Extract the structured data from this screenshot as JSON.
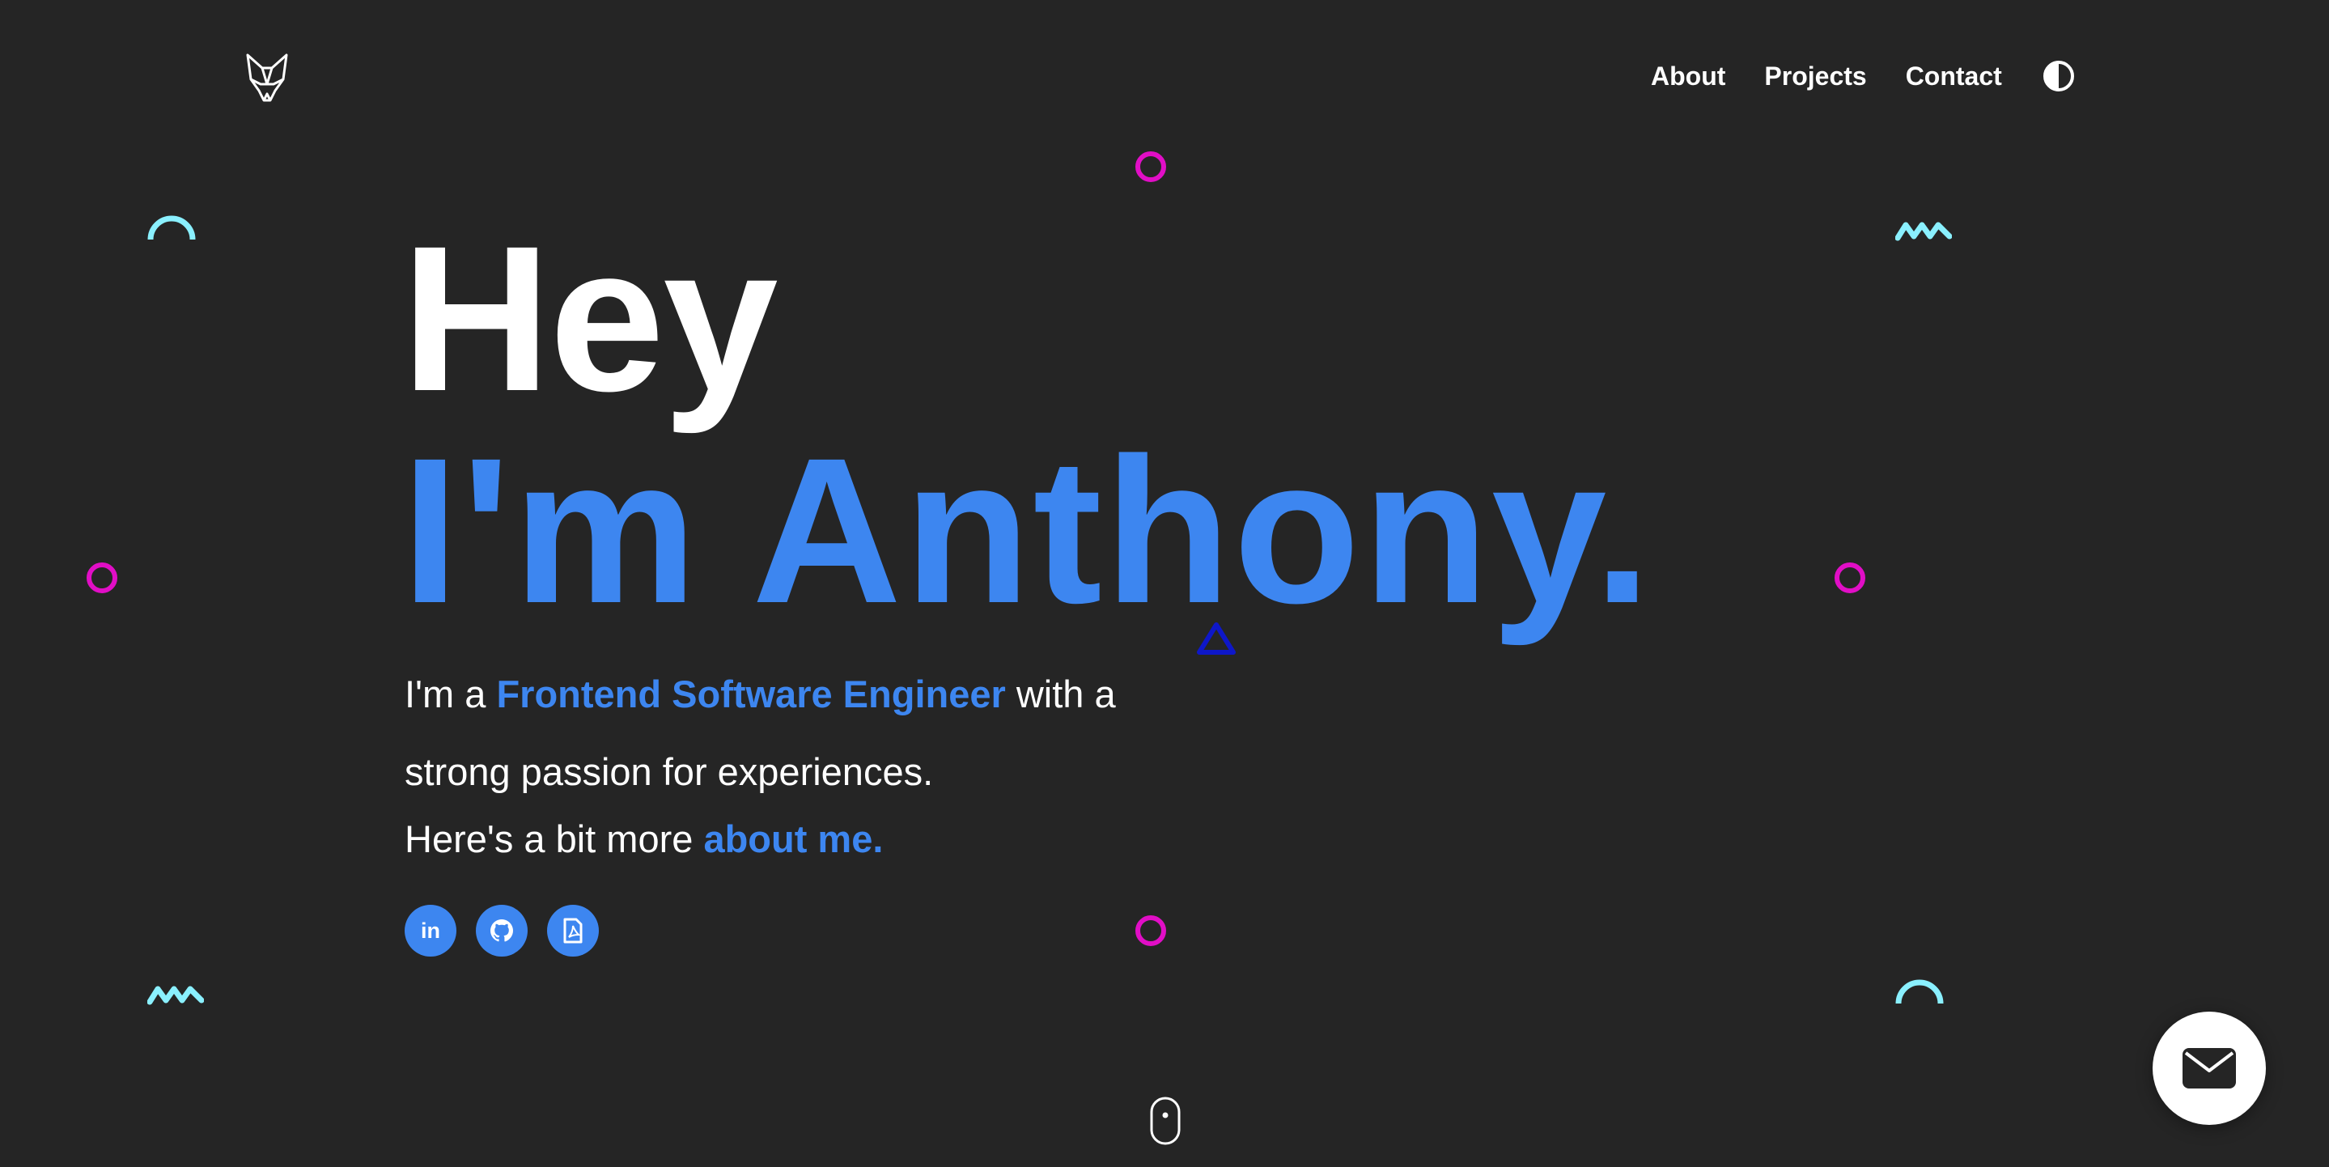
{
  "nav": {
    "logo_icon": "fox-icon",
    "links": [
      {
        "label": "About"
      },
      {
        "label": "Projects"
      },
      {
        "label": "Contact"
      }
    ],
    "theme_icon": "contrast-icon"
  },
  "hero": {
    "greeting": "Hey",
    "name": "I'm Anthony.",
    "intro_prefix": "I'm a ",
    "role": "Frontend Software Engineer",
    "intro_suffix": " with a strong passion for experiences.",
    "about_prefix": "Here's a bit more ",
    "about_link": "about me."
  },
  "socials": [
    {
      "icon": "linkedin-icon",
      "label": "in"
    },
    {
      "icon": "github-icon"
    },
    {
      "icon": "pdf-resume-icon"
    }
  ],
  "scroll_icon": "mouse-scroll-icon",
  "mail_button_icon": "envelope-icon",
  "colors": {
    "background": "#252525",
    "accent": "#3d86f0",
    "text": "#ffffff",
    "deco_magenta": "#e10ec6",
    "deco_cyan": "#8af0ff",
    "deco_navy": "#0e17c9"
  }
}
